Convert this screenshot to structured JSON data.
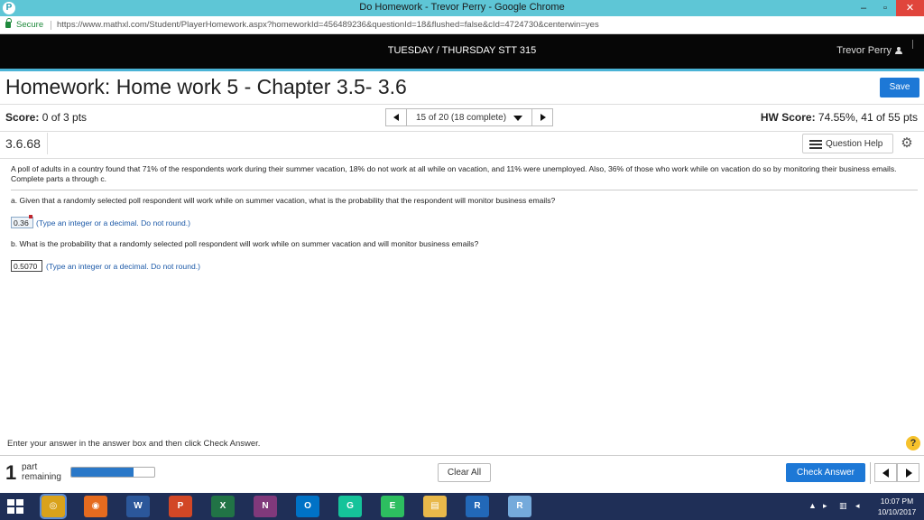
{
  "browser": {
    "window_title": "Do Homework - Trevor Perry - Google Chrome",
    "app_icon_glyph": "P",
    "secure_label": "Secure",
    "url": "https://www.mathxl.com/Student/PlayerHomework.aspx?homeworkId=456489236&questionId=18&flushed=false&cId=4724730&centerwin=yes",
    "minimize_glyph": "–",
    "maximize_glyph": "▫",
    "close_glyph": "✕"
  },
  "header": {
    "course_title": "TUESDAY / THURSDAY STT 315",
    "user_name": "Trevor Perry"
  },
  "homework": {
    "title": "Homework: Home work 5 - Chapter 3.5- 3.6",
    "save_label": "Save"
  },
  "score_row": {
    "score_label": "Score:",
    "score_value": " 0 of 3 pts",
    "question_selector": "15 of 20 (18 complete)",
    "hw_score_label": "HW Score:",
    "hw_score_value": " 74.55%, 41 of 55 pts"
  },
  "question": {
    "id": "3.6.68",
    "help_label": "Question Help",
    "intro": "A poll of adults in a country found that 71% of the respondents work during their summer vacation, 18% do not work at all while on vacation, and 11% were unemployed. Also, 36% of those who work while on vacation do so by monitoring their business emails. Complete parts a through c.",
    "part_a": "a. Given that a randomly selected poll respondent will work while on summer vacation, what is the probability that the respondent will monitor business emails?",
    "answer_a": "0.36",
    "hint_a": "(Type an integer or a decimal. Do not round.)",
    "part_b": "b. What is the probability that a randomly selected poll respondent will work while on summer vacation and will monitor business emails?",
    "answer_b": "0.5070",
    "hint_b": "(Type an integer or a decimal. Do not round.)"
  },
  "footer": {
    "instruction": "Enter your answer in the answer box and then click Check Answer.",
    "help_glyph": "?",
    "parts_count": "1",
    "parts_text_1": "part",
    "parts_text_2": "remaining",
    "progress_fraction": 0.75,
    "clear_label": "Clear All",
    "check_label": "Check Answer"
  },
  "taskbar": {
    "apps": [
      {
        "name": "chrome",
        "glyph": "◎",
        "color": "#d9a21b"
      },
      {
        "name": "firefox",
        "glyph": "◉",
        "color": "#e56b1f"
      },
      {
        "name": "word",
        "glyph": "W",
        "color": "#2b579a"
      },
      {
        "name": "powerpoint",
        "glyph": "P",
        "color": "#d24726"
      },
      {
        "name": "excel",
        "glyph": "X",
        "color": "#217346"
      },
      {
        "name": "onenote",
        "glyph": "N",
        "color": "#80397b"
      },
      {
        "name": "outlook",
        "glyph": "O",
        "color": "#0072c6"
      },
      {
        "name": "grammarly",
        "glyph": "G",
        "color": "#15c39a"
      },
      {
        "name": "evernote",
        "glyph": "E",
        "color": "#2dbe60"
      },
      {
        "name": "file-explorer",
        "glyph": "▤",
        "color": "#e8b84a"
      },
      {
        "name": "r",
        "glyph": "R",
        "color": "#2268b8"
      },
      {
        "name": "rstudio",
        "glyph": "R",
        "color": "#75aadb"
      }
    ],
    "time": "10:07 PM",
    "date": "10/10/2017",
    "colors": {
      "chrome_bar": "#5ec6d6",
      "accent": "#4ab3d6",
      "primary_button": "#1d78d6",
      "taskbar": "#1f2f57"
    }
  }
}
